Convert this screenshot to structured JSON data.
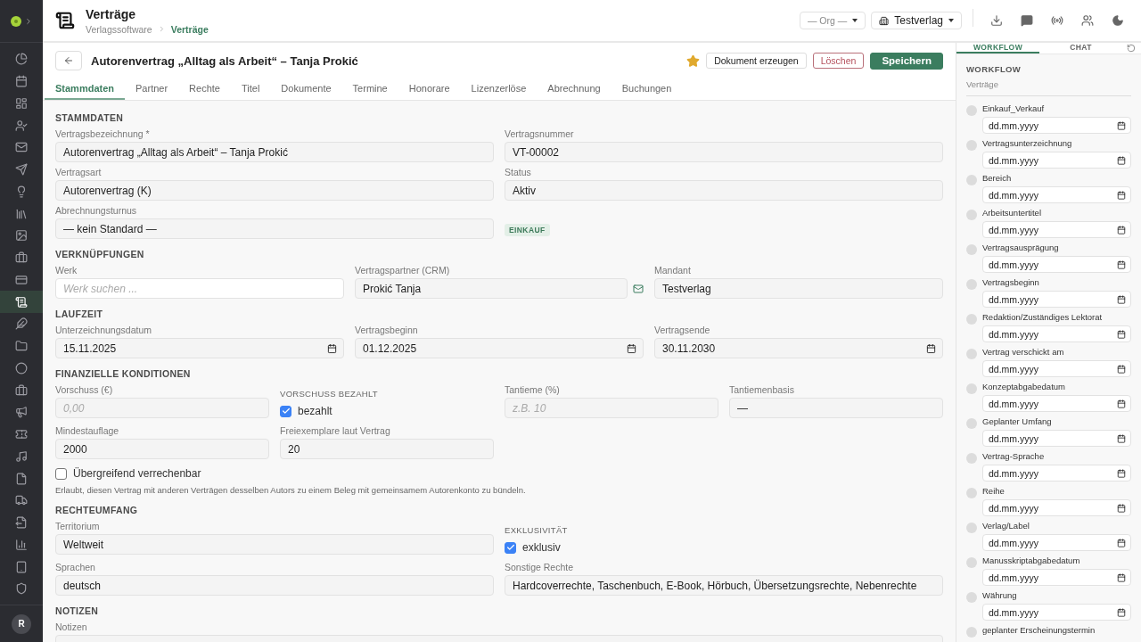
{
  "nav_rail": {
    "items": [
      {
        "selected": false
      },
      {
        "selected": false
      },
      {
        "selected": false
      },
      {
        "selected": false
      },
      {
        "selected": false
      },
      {
        "selected": false
      },
      {
        "selected": false
      },
      {
        "selected": false
      },
      {
        "selected": false
      },
      {
        "selected": false
      },
      {
        "selected": false
      },
      {
        "selected": true
      },
      {
        "selected": false
      },
      {
        "selected": false
      },
      {
        "selected": false
      },
      {
        "selected": false
      },
      {
        "selected": false
      },
      {
        "selected": false
      },
      {
        "selected": false
      },
      {
        "selected": false
      },
      {
        "selected": false
      },
      {
        "selected": false
      },
      {
        "selected": false
      },
      {
        "selected": false
      },
      {
        "selected": false
      }
    ],
    "avatar": "R"
  },
  "header": {
    "title": "Verträge",
    "breadcrumb": [
      {
        "label": "Verlagssoftware",
        "selected": false
      },
      {
        "label": "Verträge",
        "selected": true
      }
    ],
    "org_select": {
      "placeholder": "— Org —"
    },
    "company_select": {
      "value": "Testverlag"
    }
  },
  "record": {
    "title": "Autorenvertrag „Alltag als Arbeit“ – Tanja Prokić",
    "favorite": true,
    "buttons": [
      {
        "label": "Dokument erzeugen",
        "kind": "default"
      },
      {
        "label": "Löschen",
        "kind": "danger"
      },
      {
        "label": "Speichern",
        "kind": "primary"
      }
    ]
  },
  "tabs": [
    {
      "label": "Stammdaten",
      "selected": true
    },
    {
      "label": "Partner",
      "selected": false
    },
    {
      "label": "Rechte",
      "selected": false
    },
    {
      "label": "Titel",
      "selected": false
    },
    {
      "label": "Dokumente",
      "selected": false
    },
    {
      "label": "Termine",
      "selected": false
    },
    {
      "label": "Honorare",
      "selected": false
    },
    {
      "label": "Lizenzerlöse",
      "selected": false
    },
    {
      "label": "Abrechnung",
      "selected": false
    },
    {
      "label": "Buchungen",
      "selected": false
    }
  ],
  "sections": [
    {
      "title": "STAMMDATEN",
      "rows": [
        [
          {
            "kind": "text",
            "label": "Vertragsbezeichnung *",
            "value": "Autorenvertrag „Alltag als Arbeit“ – Tanja Prokić"
          },
          {
            "kind": "text",
            "label": "Vertragsnummer",
            "value": "VT-00002"
          }
        ],
        [
          {
            "kind": "text",
            "label": "Vertragsart",
            "value": "Autorenvertrag (K)"
          },
          {
            "kind": "text",
            "label": "Status",
            "value": "Aktiv"
          }
        ],
        [
          {
            "kind": "text",
            "label": "Abrechnungsturnus",
            "value": "— kein Standard —"
          },
          {
            "kind": "badge",
            "text": "EINKAUF"
          }
        ]
      ]
    },
    {
      "title": "VERKNÜPFUNGEN",
      "rows": [
        [
          {
            "kind": "search",
            "label": "Werk",
            "placeholder": "Werk suchen ..."
          },
          {
            "kind": "contact",
            "label": "Vertragspartner (CRM)",
            "value": "Prokić Tanja"
          },
          {
            "kind": "text",
            "label": "Mandant",
            "value": "Testverlag"
          }
        ]
      ]
    },
    {
      "title": "LAUFZEIT",
      "rows": [
        [
          {
            "kind": "date",
            "label": "Unterzeichnungsdatum",
            "value": "15.11.2025"
          },
          {
            "kind": "date",
            "label": "Vertragsbeginn",
            "value": "01.12.2025"
          },
          {
            "kind": "date",
            "label": "Vertragsende",
            "value": "30.11.2030"
          }
        ]
      ]
    },
    {
      "title": "FINANZIELLE KONDITIONEN",
      "rows": [
        [
          {
            "kind": "text",
            "label": "Vorschuss (€)",
            "placeholder": "0,00"
          },
          {
            "kind": "checkbox",
            "group_label": "VORSCHUSS BEZAHLT",
            "label": "bezahlt",
            "checked": true
          },
          {
            "kind": "text",
            "label": "Tantieme (%)",
            "placeholder": "z.B. 10"
          },
          {
            "kind": "text",
            "label": "Tantiemenbasis",
            "value": "—"
          }
        ],
        [
          {
            "kind": "text",
            "label": "Mindestauflage",
            "value": "2000"
          },
          {
            "kind": "text",
            "label": "Freiexemplare laut Vertrag",
            "value": "20"
          }
        ],
        [
          {
            "kind": "option",
            "label": "Übergreifend verrechenbar",
            "checked": false,
            "note": "Erlaubt, diesen Vertrag mit anderen Verträgen desselben Autors zu einem Beleg mit gemeinsamem Autorenkonto zu bündeln."
          }
        ]
      ]
    },
    {
      "title": "RECHTEUMFANG",
      "rows": [
        [
          {
            "kind": "text",
            "label": "Territorium",
            "value": "Weltweit"
          },
          {
            "kind": "checkbox",
            "group_label": "EXKLUSIVITÄT",
            "label": "exklusiv",
            "checked": true
          }
        ],
        [
          {
            "kind": "text",
            "label": "Sprachen",
            "value": "deutsch"
          },
          {
            "kind": "text",
            "label": "Sonstige Rechte",
            "value": "Hardcoverrechte, Taschenbuch, E-Book, Hörbuch, Übersetzungsrechte, Nebenrechte"
          }
        ]
      ]
    },
    {
      "title": "NOTIZEN",
      "rows": [
        [
          {
            "kind": "text",
            "label": "Notizen"
          }
        ]
      ]
    }
  ],
  "workflow": {
    "tabs": [
      {
        "label": "WORKFLOW",
        "selected": true
      },
      {
        "label": "CHAT",
        "selected": false
      }
    ],
    "title": "WORKFLOW",
    "subtitle": "Verträge",
    "steps": [
      {
        "label": "Einkauf_Verkauf",
        "done": false,
        "placeholder": "dd.mm.yyyy"
      },
      {
        "label": "Vertragsunterzeichnung",
        "done": false,
        "placeholder": "dd.mm.yyyy"
      },
      {
        "label": "Bereich",
        "done": false,
        "placeholder": "dd.mm.yyyy"
      },
      {
        "label": "Arbeitsuntertitel",
        "done": false,
        "placeholder": "dd.mm.yyyy"
      },
      {
        "label": "Vertragsausprägung",
        "done": false,
        "placeholder": "dd.mm.yyyy"
      },
      {
        "label": "Vertragsbeginn",
        "done": false,
        "placeholder": "dd.mm.yyyy"
      },
      {
        "label": "Redaktion/Zuständiges Lektorat",
        "done": false,
        "placeholder": "dd.mm.yyyy"
      },
      {
        "label": "Vertrag verschickt am",
        "done": false,
        "placeholder": "dd.mm.yyyy"
      },
      {
        "label": "Konzeptabgabedatum",
        "done": false,
        "placeholder": "dd.mm.yyyy"
      },
      {
        "label": "Geplanter Umfang",
        "done": false,
        "placeholder": "dd.mm.yyyy"
      },
      {
        "label": "Vertrag-Sprache",
        "done": false,
        "placeholder": "dd.mm.yyyy"
      },
      {
        "label": "Reihe",
        "done": false,
        "placeholder": "dd.mm.yyyy"
      },
      {
        "label": "Verlag/Label",
        "done": false,
        "placeholder": "dd.mm.yyyy"
      },
      {
        "label": "Manusskriptabgabedatum",
        "done": false,
        "placeholder": "dd.mm.yyyy"
      },
      {
        "label": "Währung",
        "done": false,
        "placeholder": "dd.mm.yyyy"
      },
      {
        "label": "geplanter Erscheinungstermin",
        "done": false
      }
    ]
  }
}
